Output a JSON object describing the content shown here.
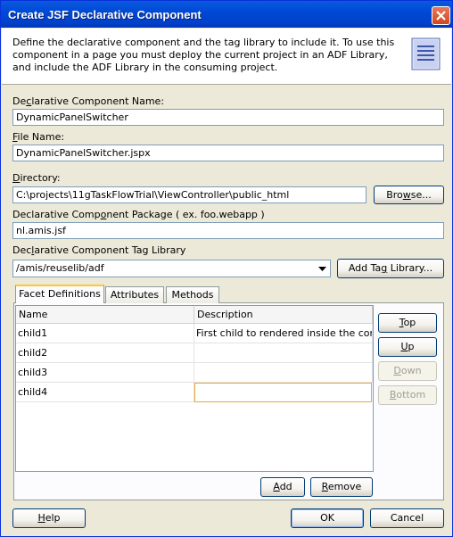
{
  "window": {
    "title": "Create JSF Declarative Component"
  },
  "header": {
    "description": "Define the declarative component and the tag library to include it.  To use this component in a page you must deploy the current project in an ADF Library, and include the ADF Library in the consuming project."
  },
  "form": {
    "component_name_label_pre": "De",
    "component_name_label_u": "c",
    "component_name_label_post": "larative Component Name:",
    "component_name_value": "DynamicPanelSwitcher",
    "file_name_label_u": "F",
    "file_name_label_post": "ile Name:",
    "file_name_value": "DynamicPanelSwitcher.jspx",
    "directory_label_u": "D",
    "directory_label_post": "irectory:",
    "directory_value": "C:\\projects\\11gTaskFlowTrial\\ViewController\\public_html",
    "browse_pre": "Bro",
    "browse_u": "w",
    "browse_post": "se...",
    "package_label_pre": "Declarative Comp",
    "package_label_u": "o",
    "package_label_post": "nent Package ( ex. foo.webapp )",
    "package_value": "nl.amis.jsf",
    "taglib_label_pre": "Dec",
    "taglib_label_u": "l",
    "taglib_label_post": "arative Component Tag Library",
    "taglib_value": "/amis/reuselib/adf",
    "add_taglib_pre": "Add Ta",
    "add_taglib_u": "g",
    "add_taglib_post": " Library..."
  },
  "tabs": [
    {
      "label": "Facet Definitions"
    },
    {
      "label": "Attributes"
    },
    {
      "label": "Methods"
    }
  ],
  "facets_table": {
    "columns": [
      "Name",
      "Description"
    ],
    "rows": [
      {
        "name": "child1",
        "description": "First child to rendered inside the conta..."
      },
      {
        "name": "child2",
        "description": ""
      },
      {
        "name": "child3",
        "description": ""
      },
      {
        "name": "child4",
        "description": ""
      }
    ]
  },
  "side_buttons": {
    "top_u": "T",
    "top_post": "op",
    "up_u": "U",
    "up_post": "p",
    "down_u": "D",
    "down_post": "own",
    "bottom_u": "B",
    "bottom_post": "ottom"
  },
  "table_buttons": {
    "add_u": "A",
    "add_post": "dd",
    "remove_u": "R",
    "remove_post": "emove"
  },
  "footer": {
    "help_u": "H",
    "help_post": "elp",
    "ok": "OK",
    "cancel": "Cancel"
  },
  "colors": {
    "titlebar": "#0049d6",
    "dialog_bg": "#ece9d8",
    "editing_cell_border": "#e8a93c"
  }
}
